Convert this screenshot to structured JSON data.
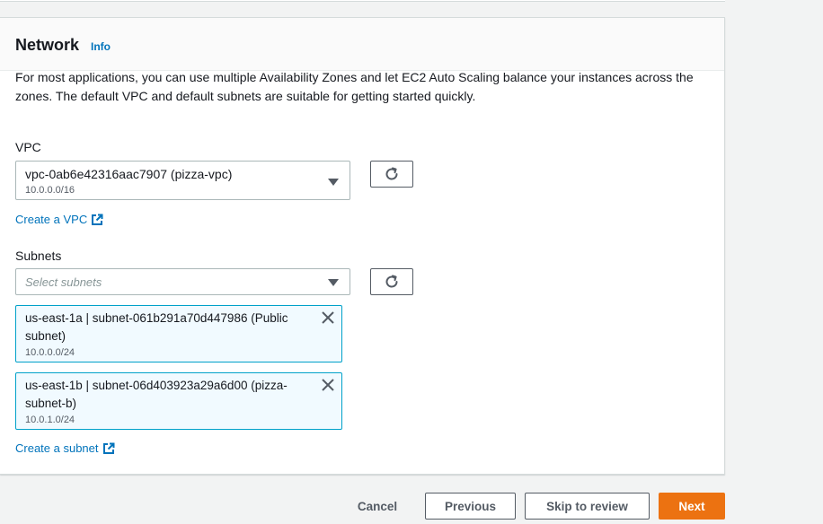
{
  "network": {
    "title": "Network",
    "info_label": "Info",
    "description": "For most applications, you can use multiple Availability Zones and let EC2 Auto Scaling balance your instances across the zones. The default VPC and default subnets are suitable for getting started quickly.",
    "vpc": {
      "label": "VPC",
      "selected_value": "vpc-0ab6e42316aac7907 (pizza-vpc)",
      "selected_cidr": "10.0.0.0/16",
      "create_link": "Create a VPC"
    },
    "subnets": {
      "label": "Subnets",
      "placeholder": "Select subnets",
      "tokens": [
        {
          "label": "us-east-1a | subnet-061b291a70d447986 (Public subnet)",
          "cidr": "10.0.0.0/24"
        },
        {
          "label": "us-east-1b | subnet-06d403923a29a6d00 (pizza-subnet-b)",
          "cidr": "10.0.1.0/24"
        }
      ],
      "create_link": "Create a subnet"
    }
  },
  "footer": {
    "cancel": "Cancel",
    "previous": "Previous",
    "skip": "Skip to review",
    "next": "Next"
  },
  "colors": {
    "link": "#0073bb",
    "primary": "#ec7211",
    "token_bg": "#f1faff",
    "token_border": "#00a1c9"
  }
}
